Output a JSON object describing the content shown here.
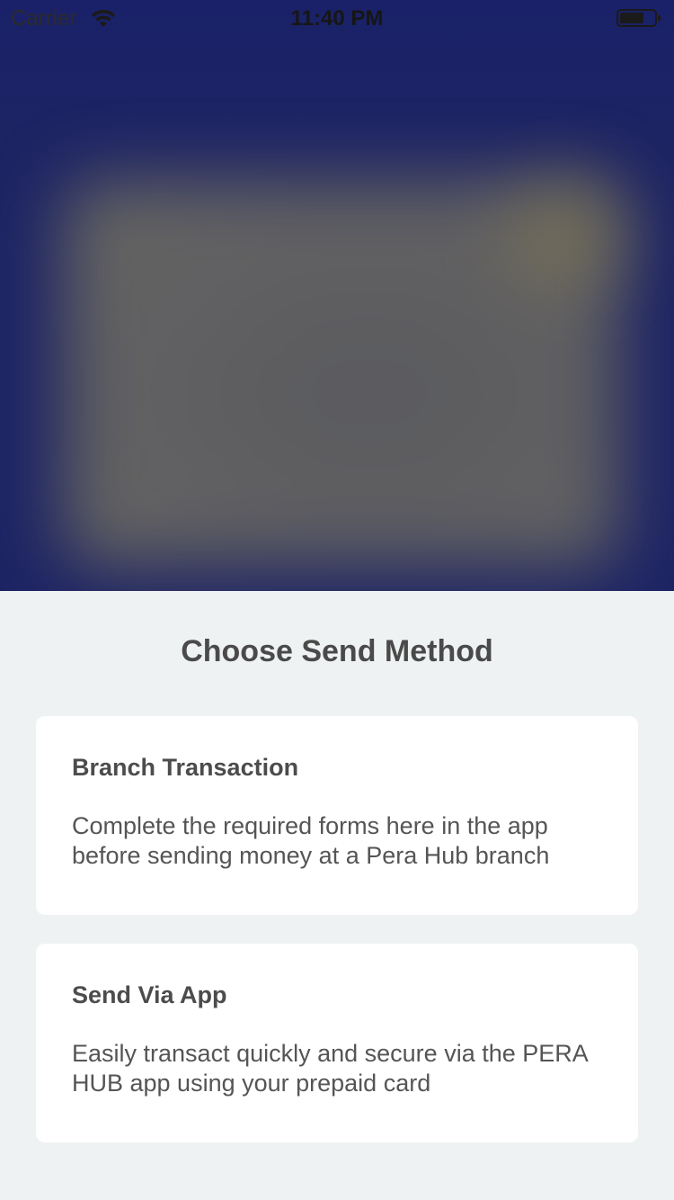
{
  "status_bar": {
    "carrier": "Carrier",
    "time": "11:40 PM",
    "wifi_icon": "wifi-icon",
    "battery_icon": "battery-icon"
  },
  "sheet": {
    "title": "Choose Send Method",
    "options": [
      {
        "title": "Branch Transaction",
        "description": "Complete the required forms here in the app before sending money at a Pera Hub branch"
      },
      {
        "title": "Send Via App",
        "description": "Easily transact quickly and secure via the PERA HUB app using your prepaid card"
      }
    ]
  },
  "colors": {
    "backdrop": "#1d2464",
    "sheet_background": "#eff2f3",
    "card_background": "#ffffff",
    "text": "#4a4a4a"
  }
}
